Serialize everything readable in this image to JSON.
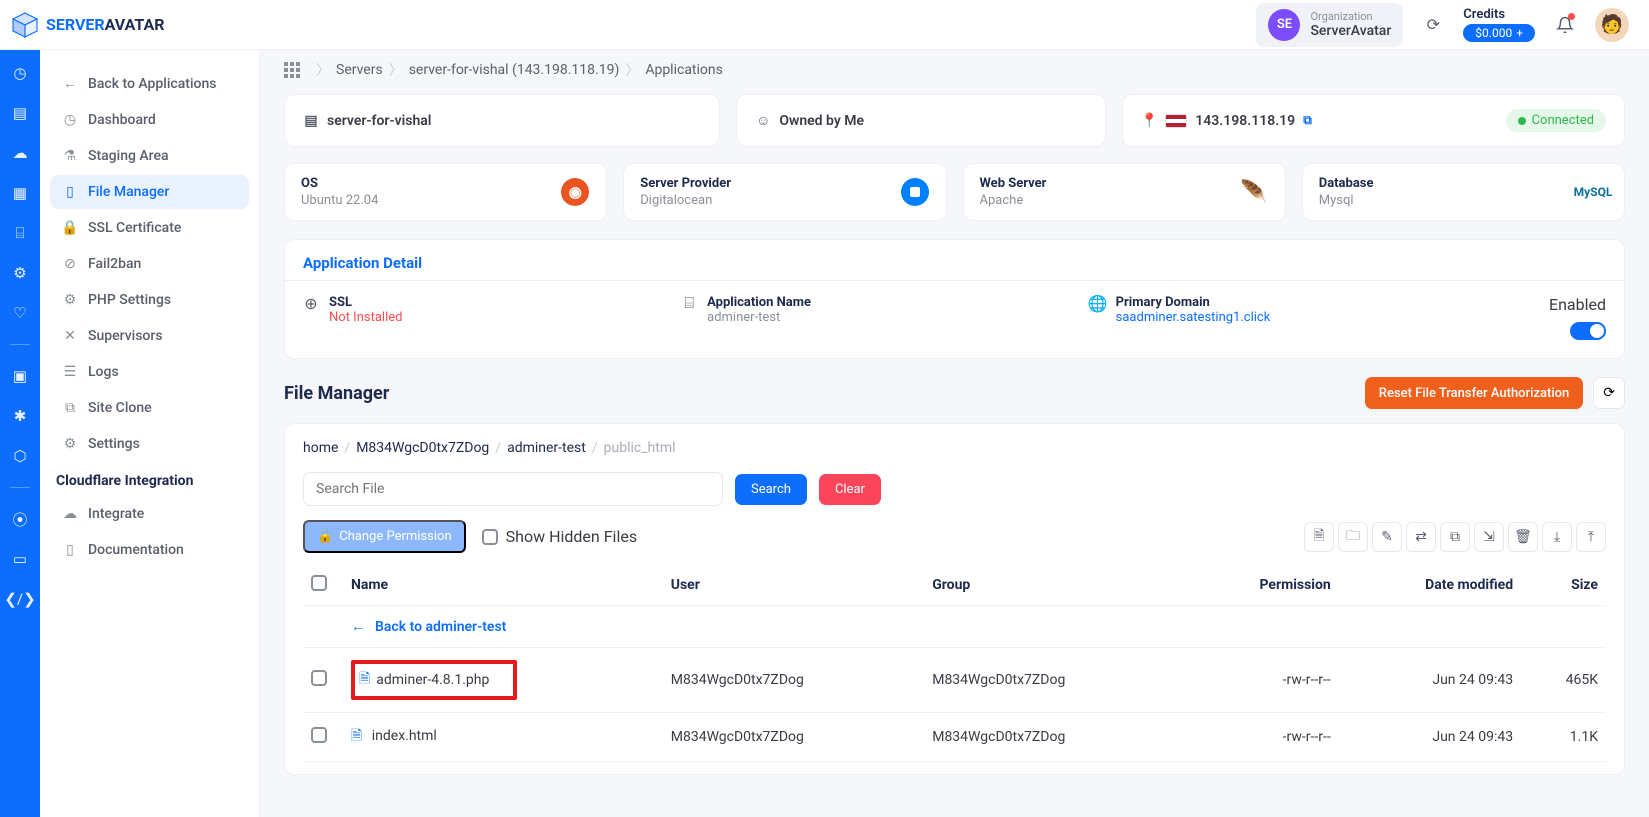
{
  "header": {
    "logo": {
      "text1": "SERVER",
      "text2": "AVATAR"
    },
    "org": {
      "label": "Organization",
      "name": "ServerAvatar",
      "badge": "SE"
    },
    "credits": {
      "label": "Credits",
      "amount": "$0.000"
    }
  },
  "sidebar": {
    "back": "Back to Applications",
    "items": [
      {
        "label": "Dashboard",
        "icon": "gauge"
      },
      {
        "label": "Staging Area",
        "icon": "flask"
      },
      {
        "label": "File Manager",
        "icon": "file",
        "active": true
      },
      {
        "label": "SSL Certificate",
        "icon": "lock"
      },
      {
        "label": "Fail2ban",
        "icon": "ban"
      },
      {
        "label": "PHP Settings",
        "icon": "sliders"
      },
      {
        "label": "Supervisors",
        "icon": "wrench"
      },
      {
        "label": "Logs",
        "icon": "file-text"
      },
      {
        "label": "Site Clone",
        "icon": "copy"
      },
      {
        "label": "Settings",
        "icon": "gear"
      }
    ],
    "cloudflare": {
      "title": "Cloudflare Integration",
      "integrate": "Integrate",
      "documentation": "Documentation"
    }
  },
  "breadcrumb": {
    "servers": "Servers",
    "server": "server-for-vishal (143.198.118.19)",
    "apps": "Applications"
  },
  "server_card": {
    "name": "server-for-vishal",
    "owner": "Owned by Me",
    "ip": "143.198.118.19",
    "status": "Connected"
  },
  "stats": {
    "os": {
      "label": "OS",
      "value": "Ubuntu 22.04"
    },
    "provider": {
      "label": "Server Provider",
      "value": "Digitalocean"
    },
    "webserver": {
      "label": "Web Server",
      "value": "Apache"
    },
    "database": {
      "label": "Database",
      "value": "Mysql"
    }
  },
  "app_detail": {
    "title": "Application Detail",
    "ssl": {
      "label": "SSL",
      "value": "Not Installed"
    },
    "appname": {
      "label": "Application Name",
      "value": "adminer-test"
    },
    "domain": {
      "label": "Primary Domain",
      "value": "saadminer.satesting1.click"
    },
    "enabled_label": "Enabled"
  },
  "fm": {
    "title": "File Manager",
    "reset_btn": "Reset File Transfer Authorization",
    "path": {
      "home": "home",
      "user": "M834WgcD0tx7ZDog",
      "app": "adminer-test",
      "folder": "public_html"
    },
    "search_placeholder": "Search File",
    "search_btn": "Search",
    "clear_btn": "Clear",
    "change_perm_btn": "Change Permission",
    "show_hidden": "Show Hidden Files",
    "columns": {
      "name": "Name",
      "user": "User",
      "group": "Group",
      "permission": "Permission",
      "date": "Date modified",
      "size": "Size"
    },
    "back_link": "Back to adminer-test",
    "rows": [
      {
        "name": "adminer-4.8.1.php",
        "user": "M834WgcD0tx7ZDog",
        "group": "M834WgcD0tx7ZDog",
        "perm": "-rw-r--r--",
        "date": "Jun 24 09:43",
        "size": "465K",
        "highlight": true
      },
      {
        "name": "index.html",
        "user": "M834WgcD0tx7ZDog",
        "group": "M834WgcD0tx7ZDog",
        "perm": "-rw-r--r--",
        "date": "Jun 24 09:43",
        "size": "1.1K",
        "highlight": false
      }
    ]
  }
}
